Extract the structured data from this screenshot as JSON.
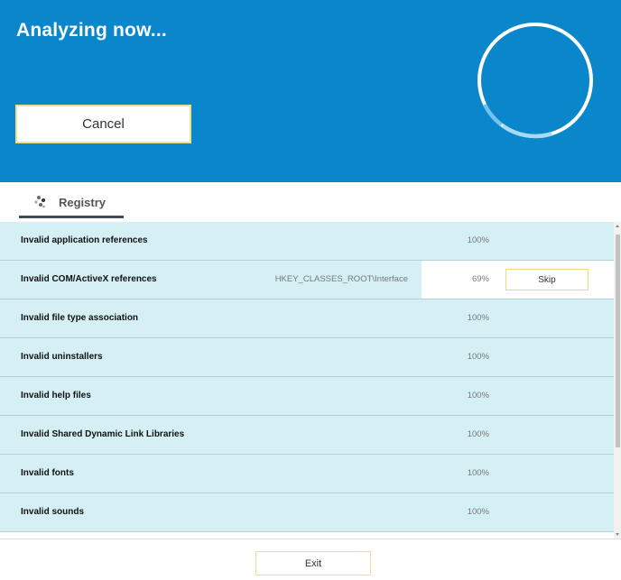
{
  "header": {
    "title": "Analyzing now...",
    "cancel_label": "Cancel",
    "background_color": "#0a86cb"
  },
  "tab": {
    "label": "Registry",
    "icon": "registry-icon"
  },
  "rows": [
    {
      "name": "Invalid application references",
      "path": "",
      "percent": "100%"
    },
    {
      "name": "Invalid COM/ActiveX references",
      "path": "HKEY_CLASSES_ROOT\\Interface",
      "percent": "69%",
      "skip_label": "Skip",
      "active": true
    },
    {
      "name": "Invalid file type association",
      "path": "",
      "percent": "100%"
    },
    {
      "name": "Invalid uninstallers",
      "path": "",
      "percent": "100%"
    },
    {
      "name": "Invalid help files",
      "path": "",
      "percent": "100%"
    },
    {
      "name": "Invalid Shared Dynamic Link Libraries",
      "path": "",
      "percent": "100%"
    },
    {
      "name": "Invalid fonts",
      "path": "",
      "percent": "100%"
    },
    {
      "name": "Invalid sounds",
      "path": "",
      "percent": "100%"
    }
  ],
  "footer": {
    "exit_label": "Exit"
  },
  "colors": {
    "row_background": "#d4f0f5",
    "button_border": "#f2df8c"
  }
}
